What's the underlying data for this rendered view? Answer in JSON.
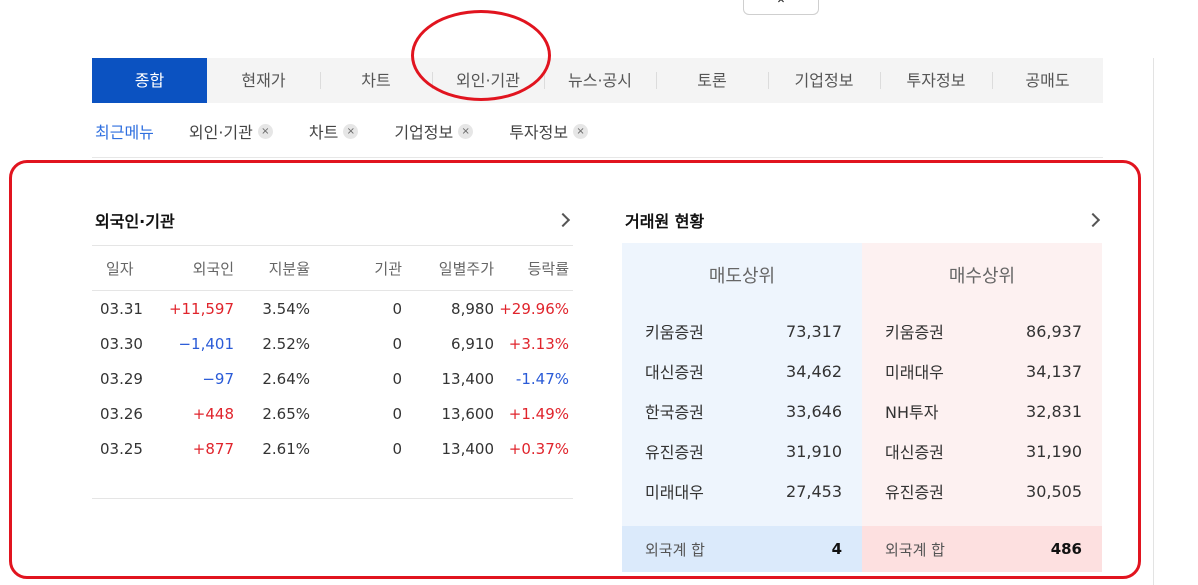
{
  "top_toggle": "⌃",
  "tabs": [
    "종합",
    "현재가",
    "차트",
    "외인·기관",
    "뉴스·공시",
    "토론",
    "기업정보",
    "투자정보",
    "공매도"
  ],
  "recent": {
    "label": "최근메뉴",
    "items": [
      "외인·기관",
      "차트",
      "기업정보",
      "투자정보"
    ],
    "close_icon": "×"
  },
  "foreign": {
    "title": "외국인·기관",
    "columns": [
      "일자",
      "외국인",
      "지분율",
      "기관",
      "일별주가",
      "등락률"
    ],
    "rows": [
      {
        "date": "03.31",
        "foreign": "+11,597",
        "share": "3.54%",
        "inst": "0",
        "price": "8,980",
        "rate": "+29.96%"
      },
      {
        "date": "03.30",
        "foreign": "−1,401",
        "share": "2.52%",
        "inst": "0",
        "price": "6,910",
        "rate": "+3.13%"
      },
      {
        "date": "03.29",
        "foreign": "−97",
        "share": "2.64%",
        "inst": "0",
        "price": "13,400",
        "rate": "-1.47%"
      },
      {
        "date": "03.26",
        "foreign": "+448",
        "share": "2.65%",
        "inst": "0",
        "price": "13,600",
        "rate": "+1.49%"
      },
      {
        "date": "03.25",
        "foreign": "+877",
        "share": "2.61%",
        "inst": "0",
        "price": "13,400",
        "rate": "+0.37%"
      }
    ]
  },
  "broker": {
    "title": "거래원 현황",
    "sell": {
      "header": "매도상위",
      "rows": [
        {
          "name": "키움증권",
          "value": "73,317"
        },
        {
          "name": "대신증권",
          "value": "34,462"
        },
        {
          "name": "한국증권",
          "value": "33,646"
        },
        {
          "name": "유진증권",
          "value": "31,910"
        },
        {
          "name": "미래대우",
          "value": "27,453"
        }
      ],
      "foot_label": "외국계 합",
      "foot_value": "4"
    },
    "buy": {
      "header": "매수상위",
      "rows": [
        {
          "name": "키움증권",
          "value": "86,937"
        },
        {
          "name": "미래대우",
          "value": "34,137"
        },
        {
          "name": "NH투자",
          "value": "32,831"
        },
        {
          "name": "대신증권",
          "value": "31,190"
        },
        {
          "name": "유진증권",
          "value": "30,505"
        }
      ],
      "foot_label": "외국계 합",
      "foot_value": "486"
    }
  },
  "colors": {
    "accent": "#0b52c1",
    "up": "#e0242c",
    "down": "#2a5bd7",
    "annotation": "#e1141f"
  }
}
